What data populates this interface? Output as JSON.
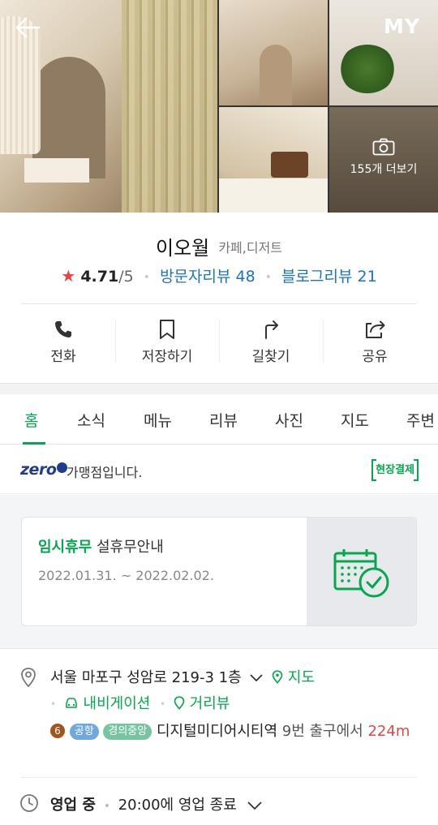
{
  "header": {
    "my_label": "MY",
    "more_photos": "155개 더보기"
  },
  "place": {
    "name": "이오월",
    "category": "카페,디저트"
  },
  "rating": {
    "star": "★",
    "score": "4.71",
    "max": "/5",
    "visitor_reviews": "방문자리뷰 48",
    "blog_reviews": "블로그리뷰 21"
  },
  "actions": [
    {
      "label": "전화",
      "icon": "phone-icon"
    },
    {
      "label": "저장하기",
      "icon": "bookmark-icon"
    },
    {
      "label": "길찾기",
      "icon": "directions-icon"
    },
    {
      "label": "공유",
      "icon": "share-icon"
    }
  ],
  "tabs": [
    "홈",
    "소식",
    "메뉴",
    "리뷰",
    "사진",
    "지도",
    "주변"
  ],
  "zeropay": {
    "logo": "zero",
    "text": "가맹점입니다.",
    "badge": "현장결제"
  },
  "closure": {
    "highlight": "임시휴무",
    "title": "설휴무안내",
    "dates": "2022.01.31. ~ 2022.02.02."
  },
  "address": {
    "text": "서울 마포구 성암로 219-3 1층",
    "map_link": "지도",
    "navigation_link": "내비게이션",
    "street_view_link": "거리뷰"
  },
  "subway": {
    "line_number": "6",
    "badge_airport": "공항",
    "badge_gyeongui": "경의중앙",
    "station": "디지털미디어시티역",
    "exit": "9번 출구에서",
    "distance": "224m"
  },
  "hours": {
    "status": "영업 중",
    "detail": "20:00에 영업 종료"
  },
  "colors": {
    "accent": "#03a94d",
    "link": "#1a74c4",
    "star": "#ef3f3f",
    "distance": "#e64545"
  }
}
